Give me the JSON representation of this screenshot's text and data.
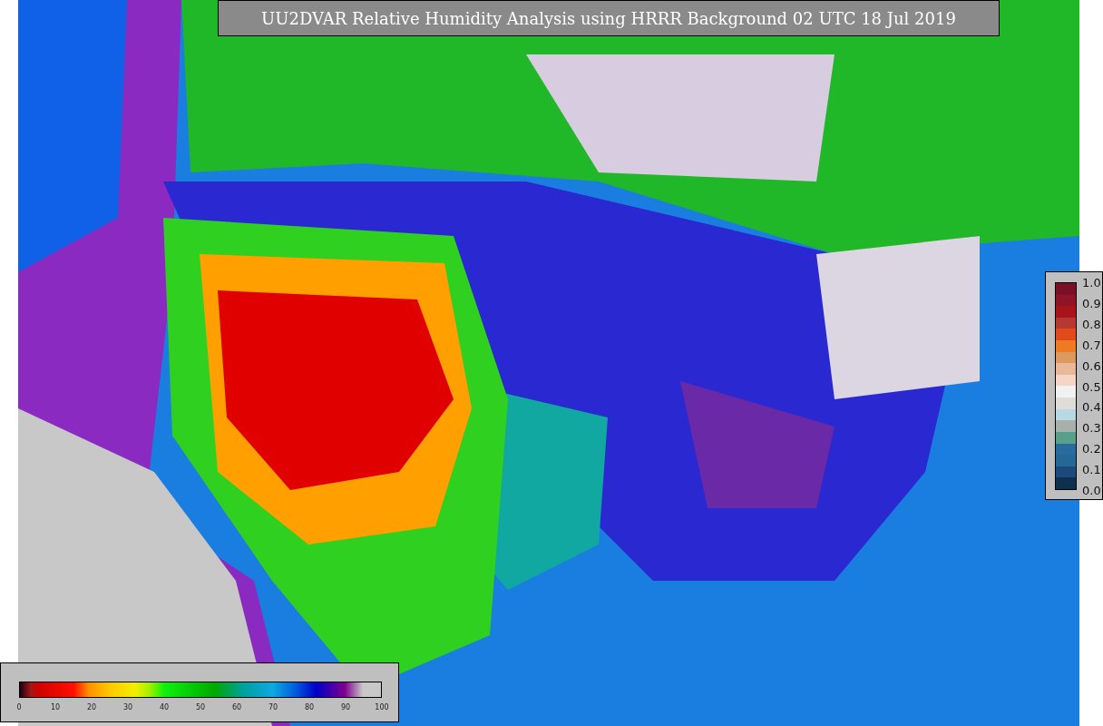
{
  "title": "UU2DVAR Relative Humidity Analysis using HRRR Background 02 UTC 18 Jul 2019",
  "humidity_colorbar": {
    "ticks": [
      "0",
      "10",
      "20",
      "30",
      "40",
      "50",
      "60",
      "70",
      "80",
      "90",
      "100"
    ]
  },
  "observation_colorbar": {
    "ticks": [
      "1.0",
      "0.9",
      "0.8",
      "0.7",
      "0.6",
      "0.5",
      "0.4",
      "0.3",
      "0.2",
      "0.1",
      "0.0"
    ]
  }
}
